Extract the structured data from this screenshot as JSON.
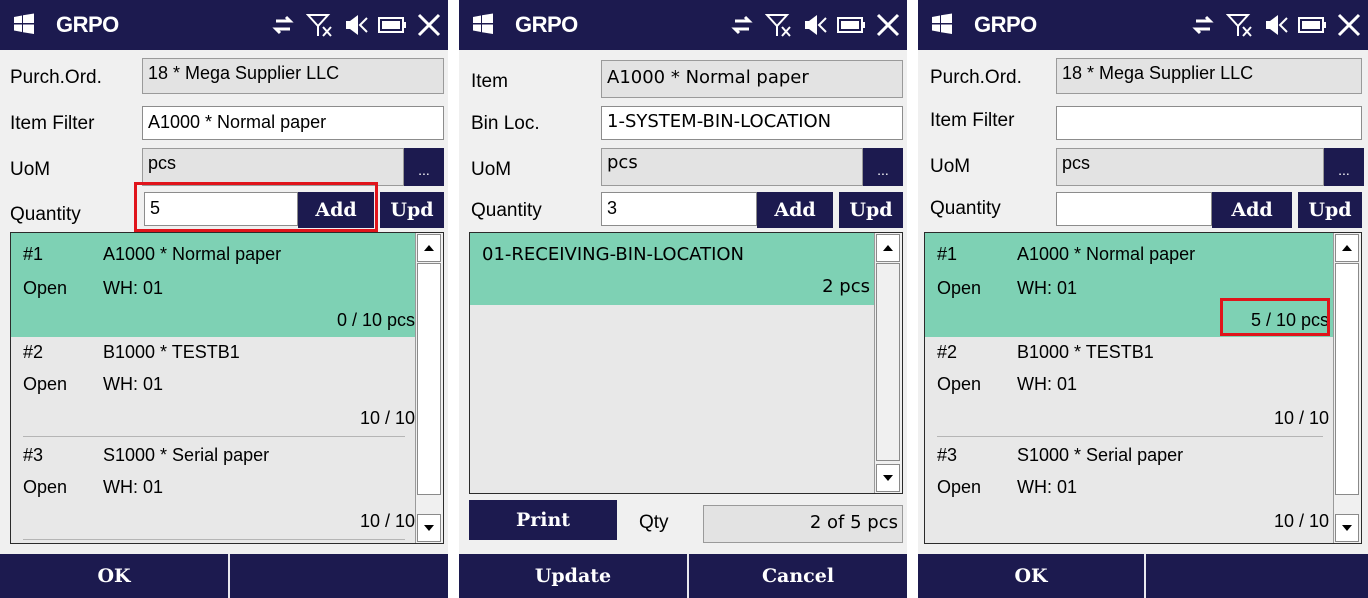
{
  "screen1": {
    "title": "GRPO",
    "purch_ord_label": "Purch.Ord.",
    "purch_ord_value": "18 * Mega Supplier LLC",
    "item_filter_label": "Item Filter",
    "item_filter_value": "A1000 * Normal paper",
    "uom_label": "UoM",
    "uom_value": "pcs",
    "uom_button": "...",
    "quantity_label": "Quantity",
    "quantity_value": "5",
    "add_label": "Add",
    "upd_label": "Upd",
    "rows": [
      {
        "num": "#1",
        "item": "A1000 * Normal paper",
        "status": "Open",
        "wh": "WH: 01",
        "qty": "0 / 10 pcs"
      },
      {
        "num": "#2",
        "item": "B1000 * TESTB1",
        "status": "Open",
        "wh": "WH: 01",
        "qty": "10 / 10"
      },
      {
        "num": "#3",
        "item": "S1000 * Serial paper",
        "status": "Open",
        "wh": "WH: 01",
        "qty": "10 / 10"
      }
    ],
    "ok_label": "OK"
  },
  "screen2": {
    "title": "GRPO",
    "item_label": "Item",
    "item_value": "A1000 * Normal paper",
    "bin_label": "Bin Loc.",
    "bin_value": "1-SYSTEM-BIN-LOCATION",
    "uom_label": "UoM",
    "uom_value": "pcs",
    "uom_button": "...",
    "quantity_label": "Quantity",
    "quantity_value": "3",
    "add_label": "Add",
    "upd_label": "Upd",
    "rows": [
      {
        "bin": "01-RECEIVING-BIN-LOCATION",
        "qty": "2 pcs"
      }
    ],
    "print_label": "Print",
    "qty_label": "Qty",
    "qty_value": "2 of 5 pcs",
    "update_label": "Update",
    "cancel_label": "Cancel"
  },
  "screen3": {
    "title": "GRPO",
    "purch_ord_label": "Purch.Ord.",
    "purch_ord_value": "18 * Mega Supplier LLC",
    "item_filter_label": "Item Filter",
    "item_filter_value": "",
    "uom_label": "UoM",
    "uom_value": "pcs",
    "uom_button": "...",
    "quantity_label": "Quantity",
    "quantity_value": "",
    "add_label": "Add",
    "upd_label": "Upd",
    "rows": [
      {
        "num": "#1",
        "item": "A1000 * Normal paper",
        "status": "Open",
        "wh": "WH: 01",
        "qty": "5 / 10 pcs"
      },
      {
        "num": "#2",
        "item": "B1000 * TESTB1",
        "status": "Open",
        "wh": "WH: 01",
        "qty": "10 / 10"
      },
      {
        "num": "#3",
        "item": "S1000 * Serial paper",
        "status": "Open",
        "wh": "WH: 01",
        "qty": "10 / 10"
      }
    ],
    "ok_label": "OK"
  },
  "colors": {
    "bar": "#1c1a4f",
    "selected_row": "#7ed1b4",
    "highlight": "#e0141b"
  }
}
